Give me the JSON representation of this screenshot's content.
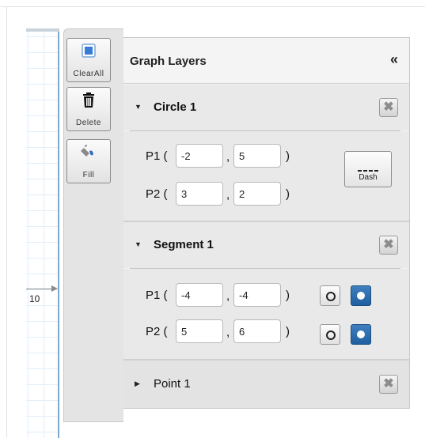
{
  "graph": {
    "axis_tick_label": "10"
  },
  "tools": {
    "clear_all": {
      "label": "ClearAll",
      "icon": "clear-all-icon"
    },
    "delete": {
      "label": "Delete",
      "icon": "trash-icon"
    },
    "fill": {
      "label": "Fill",
      "icon": "paint-bucket-icon"
    }
  },
  "panel": {
    "title": "Graph Layers",
    "collapse_glyph": "«",
    "close_glyph": "✖",
    "circle": {
      "title": "Circle 1",
      "p1_label": "P1 (",
      "p2_label": "P2 (",
      "p1_x": "-2",
      "p1_y": "5",
      "p2_x": "3",
      "p2_y": "2",
      "comma": ",",
      "paren_close": ")",
      "dash_label": "Dash"
    },
    "segment": {
      "title": "Segment 1",
      "p1_label": "P1 (",
      "p2_label": "P2 (",
      "p1_x": "-4",
      "p1_y": "-4",
      "p2_x": "5",
      "p2_y": "6",
      "comma": ",",
      "paren_close": ")"
    },
    "point": {
      "title": "Point 1"
    }
  },
  "colors": {
    "accent_blue": "#2b6cae",
    "panel_bg": "#e9e9e9"
  }
}
